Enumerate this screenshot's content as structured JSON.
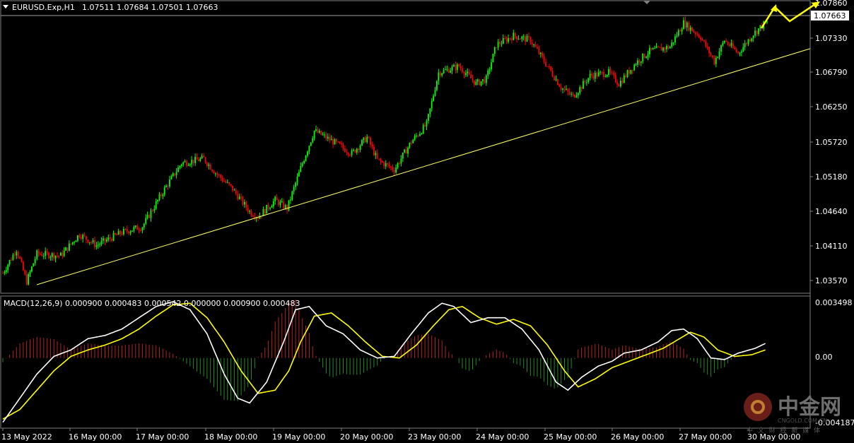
{
  "header": {
    "symbol": "EURUSD.Exp,H1",
    "ohlc": "1.07511 1.07684 1.07501 1.07663"
  },
  "macd_header": "MACD(12,26,9) 0.000900 0.000483 0.000542 0.000000 0.000900 0.000483",
  "price_axis": {
    "ticks": [
      "1.07860",
      "1.07330",
      "1.06790",
      "1.06250",
      "1.05720",
      "1.05180",
      "1.04640",
      "1.04110",
      "1.03570"
    ],
    "current_price": "1.07663"
  },
  "macd_axis": {
    "ticks": [
      "0.003498",
      "0.00",
      "-0.004187"
    ]
  },
  "time_axis": {
    "ticks": [
      "13 May 2022",
      "16 May 00:00",
      "17 May 00:00",
      "18 May 00:00",
      "19 May 00:00",
      "20 May 00:00",
      "23 May 00:00",
      "24 May 00:00",
      "25 May 00:00",
      "26 May 00:00",
      "27 May 00:00",
      "30 May 00:00"
    ]
  },
  "watermark": {
    "brand": "中金网",
    "tagline": "中 文 财 经 新 媒 体",
    "url": "CNGOLD.COM.CN"
  },
  "colors": {
    "bull": "#00ff00",
    "bear": "#ff0000",
    "trendline": "#ffff66",
    "macd_line": "#ffffff",
    "signal_line": "#ffff00",
    "hist_pos": "#b22222",
    "hist_neg": "#228b22",
    "arrow": "#ffff00"
  },
  "chart_data": [
    {
      "type": "candlestick",
      "title": "EURUSD.Exp,H1",
      "ylim": [
        1.0345,
        1.0795
      ],
      "trendline": {
        "from": [
          "13 May 2022 ~08:00",
          1.0357
        ],
        "to": [
          "30 May 00:00+",
          1.0722
        ]
      },
      "forecast_arrow": "up-zigzag",
      "price_path": [
        [
          0,
          1.0375
        ],
        [
          8,
          1.0412
        ],
        [
          14,
          1.0362
        ],
        [
          20,
          1.0405
        ],
        [
          34,
          1.0402
        ],
        [
          45,
          1.0435
        ],
        [
          55,
          1.0418
        ],
        [
          70,
          1.0438
        ],
        [
          82,
          1.0447
        ],
        [
          95,
          1.0505
        ],
        [
          105,
          1.0545
        ],
        [
          118,
          1.0552
        ],
        [
          125,
          1.053
        ],
        [
          135,
          1.0505
        ],
        [
          145,
          1.047
        ],
        [
          150,
          1.0462
        ],
        [
          160,
          1.0488
        ],
        [
          167,
          1.0475
        ],
        [
          176,
          1.0545
        ],
        [
          183,
          1.0595
        ],
        [
          193,
          1.058
        ],
        [
          205,
          1.056
        ],
        [
          214,
          1.0585
        ],
        [
          220,
          1.055
        ],
        [
          230,
          1.0535
        ],
        [
          240,
          1.0578
        ],
        [
          249,
          1.0605
        ],
        [
          256,
          1.0685
        ],
        [
          268,
          1.0695
        ],
        [
          278,
          1.0668
        ],
        [
          284,
          1.0675
        ],
        [
          290,
          1.0728
        ],
        [
          300,
          1.0742
        ],
        [
          310,
          1.0735
        ],
        [
          320,
          1.0695
        ],
        [
          328,
          1.0662
        ],
        [
          335,
          1.0648
        ],
        [
          345,
          1.068
        ],
        [
          356,
          1.0685
        ],
        [
          362,
          1.0668
        ],
        [
          372,
          1.07
        ],
        [
          380,
          1.0718
        ],
        [
          392,
          1.0725
        ],
        [
          400,
          1.0762
        ],
        [
          410,
          1.074
        ],
        [
          418,
          1.0702
        ],
        [
          424,
          1.0735
        ],
        [
          432,
          1.0715
        ],
        [
          441,
          1.0745
        ],
        [
          448,
          1.0762
        ]
      ],
      "price_ticks": [
        "1.07860",
        "1.07330",
        "1.06790",
        "1.06250",
        "1.05720",
        "1.05180",
        "1.04640",
        "1.04110",
        "1.03570"
      ],
      "time_ticks": [
        "13 May 2022",
        "16 May 00:00",
        "17 May 00:00",
        "18 May 00:00",
        "19 May 00:00",
        "20 May 00:00",
        "23 May 00:00",
        "24 May 00:00",
        "25 May 00:00",
        "26 May 00:00",
        "27 May 00:00",
        "30 May 00:00"
      ]
    },
    {
      "type": "line",
      "title": "MACD(12,26,9)",
      "ylim": [
        -0.004187,
        0.003498
      ],
      "series": [
        {
          "name": "MACD",
          "points": [
            [
              0,
              -0.004
            ],
            [
              10,
              -0.0025
            ],
            [
              20,
              -0.001
            ],
            [
              30,
              0.0001
            ],
            [
              40,
              0.0005
            ],
            [
              50,
              0.0012
            ],
            [
              60,
              0.0014
            ],
            [
              70,
              0.0018
            ],
            [
              80,
              0.0025
            ],
            [
              90,
              0.0032
            ],
            [
              100,
              0.0035
            ],
            [
              110,
              0.003
            ],
            [
              120,
              0.0015
            ],
            [
              130,
              -0.001
            ],
            [
              138,
              -0.0025
            ],
            [
              145,
              -0.0028
            ],
            [
              155,
              -0.0015
            ],
            [
              165,
              0.001
            ],
            [
              172,
              0.003
            ],
            [
              180,
              0.0032
            ],
            [
              190,
              0.002
            ],
            [
              200,
              0.0015
            ],
            [
              210,
              0.0005
            ],
            [
              220,
              0.0
            ],
            [
              230,
              0.0001
            ],
            [
              240,
              0.0015
            ],
            [
              250,
              0.0028
            ],
            [
              258,
              0.0034
            ],
            [
              265,
              0.0032
            ],
            [
              275,
              0.0022
            ],
            [
              285,
              0.0025
            ],
            [
              295,
              0.0025
            ],
            [
              305,
              0.0018
            ],
            [
              315,
              0.0005
            ],
            [
              325,
              -0.0015
            ],
            [
              332,
              -0.002
            ],
            [
              340,
              -0.0012
            ],
            [
              350,
              -0.0005
            ],
            [
              358,
              -0.0002
            ],
            [
              365,
              0.0003
            ],
            [
              375,
              0.0005
            ],
            [
              385,
              0.001
            ],
            [
              393,
              0.0017
            ],
            [
              400,
              0.0018
            ],
            [
              408,
              0.0012
            ],
            [
              416,
              0.0
            ],
            [
              424,
              -0.0001
            ],
            [
              432,
              0.0003
            ],
            [
              442,
              0.0006
            ],
            [
              448,
              0.0009
            ]
          ]
        },
        {
          "name": "Signal",
          "points": [
            [
              0,
              -0.0038
            ],
            [
              10,
              -0.0032
            ],
            [
              20,
              -0.002
            ],
            [
              30,
              -0.0008
            ],
            [
              40,
              0.0001
            ],
            [
              50,
              0.0005
            ],
            [
              60,
              0.0008
            ],
            [
              70,
              0.0012
            ],
            [
              80,
              0.0018
            ],
            [
              90,
              0.0026
            ],
            [
              100,
              0.0033
            ],
            [
              110,
              0.0034
            ],
            [
              120,
              0.0025
            ],
            [
              130,
              0.001
            ],
            [
              140,
              -0.0008
            ],
            [
              150,
              -0.0022
            ],
            [
              160,
              -0.002
            ],
            [
              168,
              -0.0008
            ],
            [
              175,
              0.001
            ],
            [
              183,
              0.0026
            ],
            [
              193,
              0.0028
            ],
            [
              203,
              0.002
            ],
            [
              213,
              0.001
            ],
            [
              223,
              0.0001
            ],
            [
              233,
              0.0
            ],
            [
              243,
              0.0008
            ],
            [
              253,
              0.002
            ],
            [
              262,
              0.003
            ],
            [
              270,
              0.0032
            ],
            [
              280,
              0.0025
            ],
            [
              290,
              0.0021
            ],
            [
              300,
              0.0024
            ],
            [
              310,
              0.002
            ],
            [
              320,
              0.0008
            ],
            [
              330,
              -0.0008
            ],
            [
              338,
              -0.0018
            ],
            [
              348,
              -0.0013
            ],
            [
              358,
              -0.0006
            ],
            [
              368,
              -0.0002
            ],
            [
              378,
              0.0002
            ],
            [
              388,
              0.0006
            ],
            [
              396,
              0.0011
            ],
            [
              404,
              0.0016
            ],
            [
              412,
              0.0013
            ],
            [
              420,
              0.0005
            ],
            [
              430,
              0.0001
            ],
            [
              440,
              0.0002
            ],
            [
              448,
              0.0005
            ]
          ]
        }
      ],
      "histogram": "bars = MACD minus Signal (scaled)"
    }
  ]
}
